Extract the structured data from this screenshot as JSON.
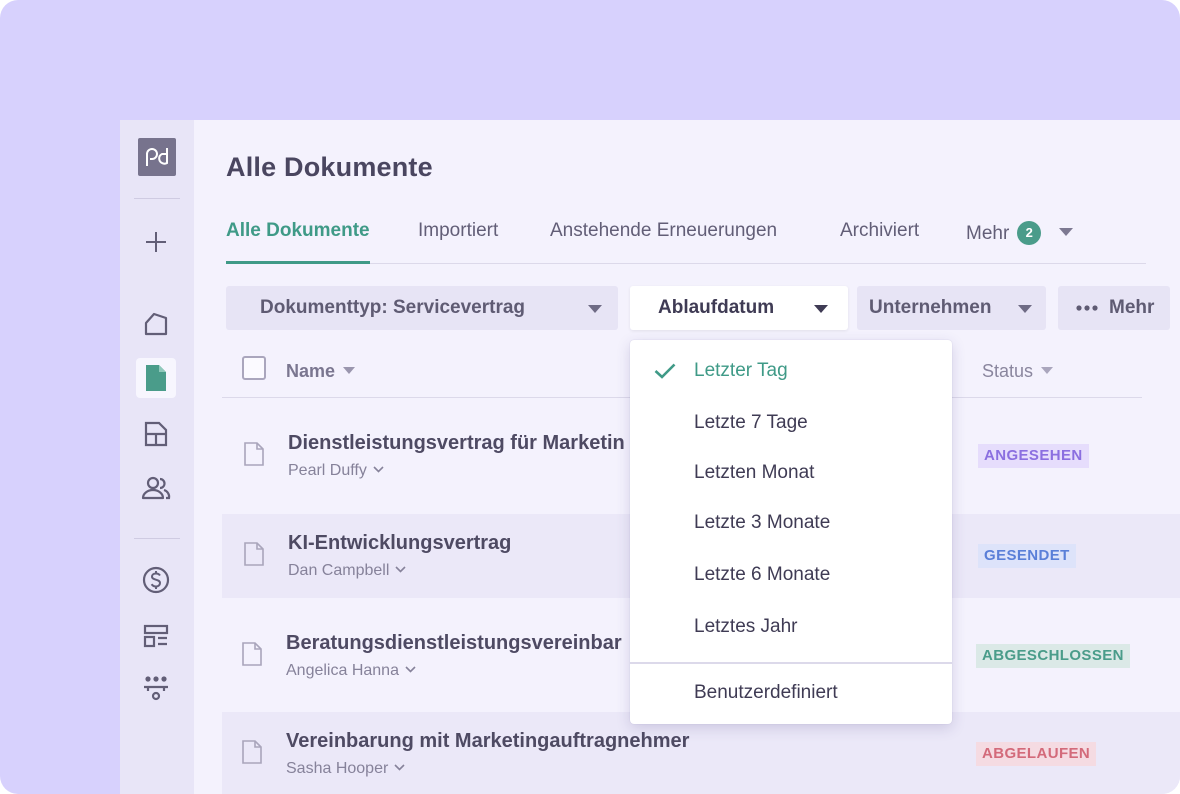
{
  "colors": {
    "background": "#d7d1fd",
    "app": "#f4f2fd",
    "accent": "#3f9a87",
    "status_viewed": "#8b6fe0",
    "status_sent": "#5a7fd8",
    "status_completed": "#4a9c8a",
    "status_expired": "#d36a7a"
  },
  "sidebar": {
    "logo_text": "pd",
    "items": [
      {
        "icon": "plus-icon"
      },
      {
        "icon": "home-icon"
      },
      {
        "icon": "document-icon",
        "active": true
      },
      {
        "icon": "template-icon"
      },
      {
        "icon": "contacts-icon"
      },
      {
        "icon": "dollar-icon"
      },
      {
        "icon": "forms-icon"
      },
      {
        "icon": "workflow-icon"
      }
    ]
  },
  "header": {
    "title": "Alle Dokumente"
  },
  "tabs": [
    {
      "label": "Alle Dokumente",
      "active": true
    },
    {
      "label": "Importiert"
    },
    {
      "label": "Anstehende Erneuerungen"
    },
    {
      "label": "Archiviert"
    },
    {
      "label": "Mehr",
      "badge": "2"
    }
  ],
  "filters": {
    "document_type": "Dokumenttyp: Servicevertrag",
    "expiry": "Ablaufdatum",
    "company": "Unternehmen",
    "more": "Mehr"
  },
  "table": {
    "columns": {
      "name": "Name",
      "status": "Status"
    },
    "rows": [
      {
        "title": "Dienstleistungsvertrag für Marketin",
        "owner": "Pearl Duffy",
        "status": "ANGESEHEN"
      },
      {
        "title": "KI-Entwicklungsvertrag",
        "owner": "Dan Campbell",
        "status": "GESENDET"
      },
      {
        "title": "Beratungsdienstleistungsvereinbar",
        "owner": "Angelica Hanna",
        "status": "ABGESCHLOSSEN"
      },
      {
        "title": "Vereinbarung mit Marketingauftragnehmer",
        "owner": "Sasha Hooper",
        "status": "ABGELAUFEN"
      }
    ]
  },
  "dropdown": {
    "options": [
      {
        "label": "Letzter Tag",
        "selected": true
      },
      {
        "label": "Letzte 7 Tage"
      },
      {
        "label": "Letzten Monat"
      },
      {
        "label": "Letzte 3 Monate"
      },
      {
        "label": "Letzte 6 Monate"
      },
      {
        "label": "Letztes Jahr"
      }
    ],
    "custom": "Benutzerdefiniert"
  }
}
